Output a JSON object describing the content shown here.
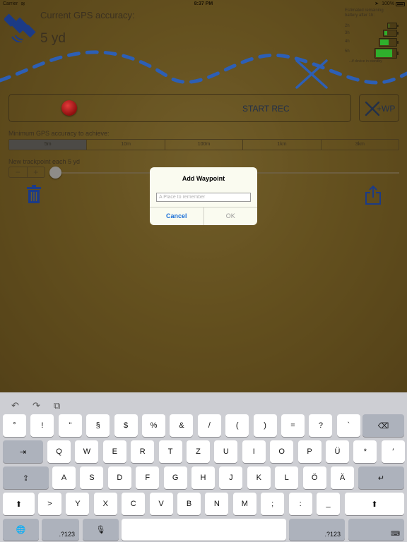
{
  "status_bar": {
    "carrier": "Carrier",
    "time": "8:37 PM",
    "battery": "100%"
  },
  "gps": {
    "title": "Current GPS accuracy:",
    "value": "5 yd"
  },
  "battery_panel": {
    "title": "Estimated remaining battery after 1h:",
    "rows": [
      {
        "label": "2h",
        "level": 0.12
      },
      {
        "label": "3h",
        "level": 0.25
      },
      {
        "label": "4h",
        "level": 0.55
      },
      {
        "label": "5h",
        "level": 0.82
      }
    ],
    "footer": "...if device in standby"
  },
  "record": {
    "label": "START REC"
  },
  "waypoint_button": {
    "label": "+WP"
  },
  "accuracy": {
    "label": "Minimum GPS accuracy to achieve:",
    "options": [
      "5m",
      "10m",
      "100m",
      "1km",
      "3km"
    ],
    "selected_index": 0
  },
  "trackpoint": {
    "label": "New trackpoint each 5 yd",
    "stepper_minus": "−",
    "stepper_plus": "+",
    "slider_value": 0
  },
  "dialog": {
    "title": "Add Waypoint",
    "placeholder": "A Place to remember",
    "cancel": "Cancel",
    "ok": "OK"
  },
  "keyboard": {
    "toolbar": [
      "undo-icon",
      "redo-icon",
      "paste-icon"
    ],
    "row1": [
      "°",
      "!",
      "\"",
      "§",
      "$",
      "%",
      "&",
      "/",
      "(",
      ")",
      "=",
      "?",
      "`"
    ],
    "row2": [
      "Q",
      "W",
      "E",
      "R",
      "T",
      "Z",
      "U",
      "I",
      "O",
      "P",
      "Ü",
      "*",
      "′"
    ],
    "row3": [
      "A",
      "S",
      "D",
      "F",
      "G",
      "H",
      "J",
      "K",
      "L",
      "Ö",
      "Ä"
    ],
    "row4": [
      ">",
      "Y",
      "X",
      "C",
      "V",
      "B",
      "N",
      "M",
      ";",
      ":",
      "_"
    ],
    "numbers_label": ".?123",
    "tab_glyph": "⇥",
    "caps_glyph": "⇪",
    "shift_glyph": "⬆",
    "delete_glyph": "⌫",
    "return_glyph": "↵",
    "globe_glyph": "🌐",
    "mic_glyph": "🎙",
    "hide_glyph": "⌨"
  }
}
